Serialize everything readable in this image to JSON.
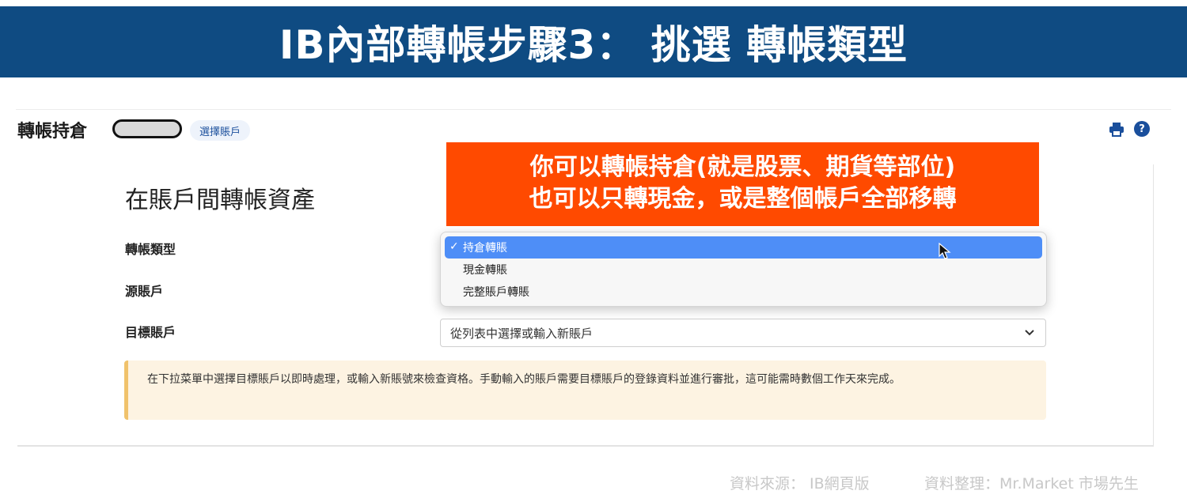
{
  "banner": {
    "title": "IB內部轉帳步驟3： 挑選 轉帳類型"
  },
  "header": {
    "title": "轉帳持倉",
    "select_account_label": "選擇賬戶",
    "print_icon": "printer-icon",
    "help_icon": "question-circle-icon",
    "help_glyph": "?"
  },
  "form": {
    "section_title": "在賬戶間轉帳資產",
    "transfer_type_label": "轉帳類型",
    "source_label": "源賬戶",
    "target_label": "目標賬戶",
    "target_placeholder": "從列表中選擇或輸入新賬戶",
    "transfer_type_options": [
      "持倉轉賬",
      "現金轉賬",
      "完整賬戶轉賬"
    ],
    "selected_index": 0,
    "check_glyph": "✓"
  },
  "notice": {
    "text": "在下拉菜單中選擇目標賬戶以即時處理，或輸入新賬號來檢查資格。手動輸入的賬戶需要目標賬戶的登錄資料並進行審批，這可能需時數個工作天來完成。"
  },
  "callout": {
    "line1": "你可以轉帳持倉(就是股票、期貨等部位)",
    "line2": "也可以只轉現金，或是整個帳戶全部移轉"
  },
  "footer": {
    "source": "資料來源： IB網頁版",
    "compiled_by": "資料整理：Mr.Market 市場先生"
  },
  "colors": {
    "banner_bg": "#0f4b82",
    "callout_bg": "#ff4a00",
    "selected_option_bg": "#4e8ef7",
    "notice_bg": "#fdf3e2",
    "brand_blue": "#1a4f9c"
  }
}
